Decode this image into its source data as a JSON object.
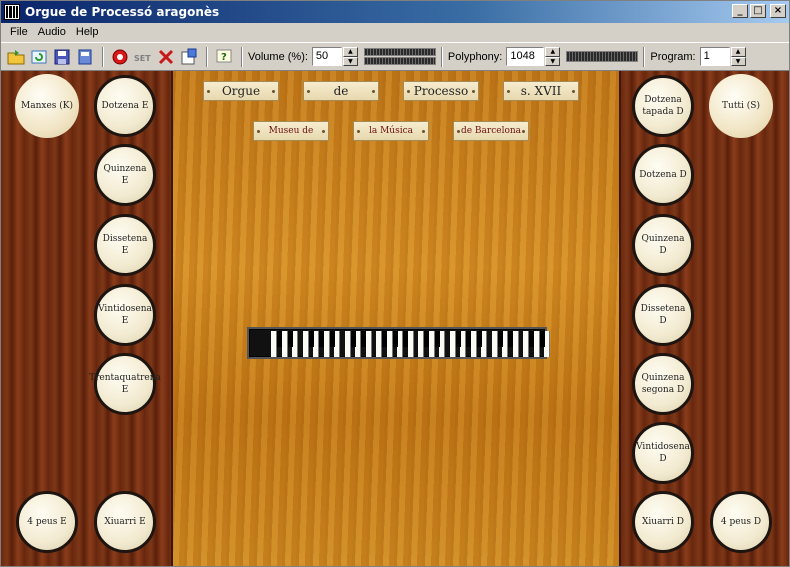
{
  "window": {
    "title": "Orgue de Processó aragonès"
  },
  "menu": {
    "items": [
      "File",
      "Audio",
      "Help"
    ]
  },
  "toolbar": {
    "volume_label": "Volume (%):",
    "volume_value": "50",
    "polyphony_label": "Polyphony:",
    "polyphony_value": "1048",
    "program_label": "Program:",
    "program_value": "1",
    "icons": [
      "open-folder-icon",
      "reload-icon",
      "save-icon",
      "save-as-icon",
      "record-icon",
      "settings-icon",
      "panic-icon",
      "properties-icon",
      "help-icon"
    ]
  },
  "title_plates": [
    "Orgue",
    "de",
    "Processo",
    "s. XVII"
  ],
  "subtitle_plates": [
    "Museu de",
    "la Música",
    "de Barcelona"
  ],
  "left_stops": [
    "Manxes (K)",
    "Dotzena E",
    "Quinzena E",
    "Dissetena E",
    "Vintidosena E",
    "Trentaquatrena E",
    "4 peus E",
    "Xiuarri E"
  ],
  "right_stops": [
    "Dotzena tapada D",
    "Tutti (S)",
    "Dotzena D",
    "Quinzena D",
    "Dissetena D",
    "Quinzena segona D",
    "Vintidosena D",
    "Xiuarri D",
    "4 peus D"
  ],
  "keyboard": {
    "white_keys": 27
  }
}
